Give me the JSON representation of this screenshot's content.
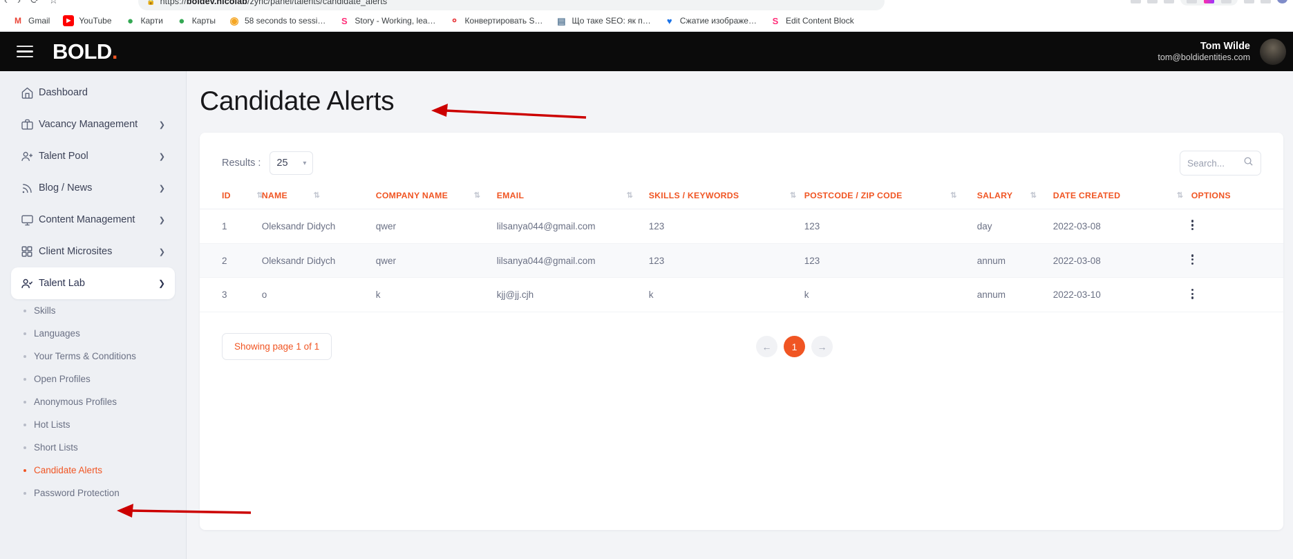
{
  "browser": {
    "url": "https://",
    "url_bold": "boldev.nicolab",
    "url_rest": "/zync/panel/talents/candidate_alerts",
    "nav_back": "‹",
    "nav_forward": "›",
    "nav_reload": "⟳",
    "nav_bookmark": "☆",
    "bookmarks": [
      {
        "label": "Gmail",
        "icon": "gmail-icon",
        "glyph": "M",
        "color": "#ea4335"
      },
      {
        "label": "YouTube",
        "icon": "youtube-icon",
        "glyph": "▶",
        "color": "#ff0000"
      },
      {
        "label": "Карти",
        "icon": "google-maps-pin-icon",
        "glyph": "◉",
        "color": "#34a853"
      },
      {
        "label": "Карты",
        "icon": "google-maps-pin-icon",
        "glyph": "◉",
        "color": "#34a853"
      },
      {
        "label": "58 seconds to sessi…",
        "icon": "target-icon",
        "glyph": "◉",
        "color": "#f5a623"
      },
      {
        "label": "Story - Working, lea…",
        "icon": "s-logo-icon",
        "glyph": ".S",
        "color": "#ff2d78"
      },
      {
        "label": "Конвертировать S…",
        "icon": "prohibit-icon",
        "glyph": "⊘",
        "color": "#e8373c"
      },
      {
        "label": "Що таке SEO: як п…",
        "icon": "monitor-icon",
        "glyph": "▣",
        "color": "#5b7c99"
      },
      {
        "label": "Сжатие изображе…",
        "icon": "heart-icon",
        "glyph": "♥",
        "color": "#1a73e8"
      },
      {
        "label": "Edit Content Block",
        "icon": "s-logo-icon",
        "glyph": ".S",
        "color": "#ff2d78"
      }
    ]
  },
  "topbar": {
    "brand": "BOLD",
    "brand_dot": ".",
    "user_name": "Tom Wilde",
    "user_email": "tom@boldidentities.com"
  },
  "sidebar": {
    "items": [
      {
        "label": "Dashboard",
        "icon": "home-icon",
        "has_chevron": false
      },
      {
        "label": "Vacancy Management",
        "icon": "briefcase-icon",
        "has_chevron": true
      },
      {
        "label": "Talent Pool",
        "icon": "user-plus-icon",
        "has_chevron": true
      },
      {
        "label": "Blog / News",
        "icon": "rss-icon",
        "has_chevron": true
      },
      {
        "label": "Content Management",
        "icon": "monitor-icon",
        "has_chevron": true
      },
      {
        "label": "Client Microsites",
        "icon": "grid-icon",
        "has_chevron": true
      },
      {
        "label": "Talent Lab",
        "icon": "user-check-icon",
        "has_chevron": true,
        "active": true,
        "expanded": true
      }
    ],
    "sub_items": [
      {
        "label": "Skills"
      },
      {
        "label": "Languages"
      },
      {
        "label": "Your Terms & Conditions"
      },
      {
        "label": "Open Profiles"
      },
      {
        "label": "Anonymous Profiles"
      },
      {
        "label": "Hot Lists"
      },
      {
        "label": "Short Lists"
      },
      {
        "label": "Candidate Alerts",
        "current": true
      },
      {
        "label": "Password Protection"
      }
    ]
  },
  "main": {
    "page_title": "Candidate Alerts",
    "results_label": "Results :",
    "results_value": "25",
    "search_placeholder": "Search...",
    "search_value": "",
    "table": {
      "headers": [
        "ID",
        "NAME",
        "COMPANY NAME",
        "EMAIL",
        "SKILLS / KEYWORDS",
        "POSTCODE / ZIP CODE",
        "SALARY",
        "DATE CREATED",
        "OPTIONS"
      ],
      "rows": [
        {
          "id": "1",
          "name": "Oleksandr Didych",
          "company": "qwer",
          "email": "lilsanya044@gmail.com",
          "skills": "123",
          "postcode": "123",
          "salary": "day",
          "date": "2022-03-08"
        },
        {
          "id": "2",
          "name": "Oleksandr Didych",
          "company": "qwer",
          "email": "lilsanya044@gmail.com",
          "skills": "123",
          "postcode": "123",
          "salary": "annum",
          "date": "2022-03-08"
        },
        {
          "id": "3",
          "name": "o",
          "company": "k",
          "email": "kjj@jj.cjh",
          "skills": "k",
          "postcode": "k",
          "salary": "annum",
          "date": "2022-03-10"
        }
      ]
    },
    "pagination": {
      "showing": "Showing page 1 of 1",
      "prev": "←",
      "next": "→",
      "current_page": "1"
    }
  },
  "colors": {
    "accent": "#f05523",
    "topbar_bg": "#0b0b0b",
    "sidebar_bg": "#eef0f4",
    "annotation": "#cc0000"
  }
}
